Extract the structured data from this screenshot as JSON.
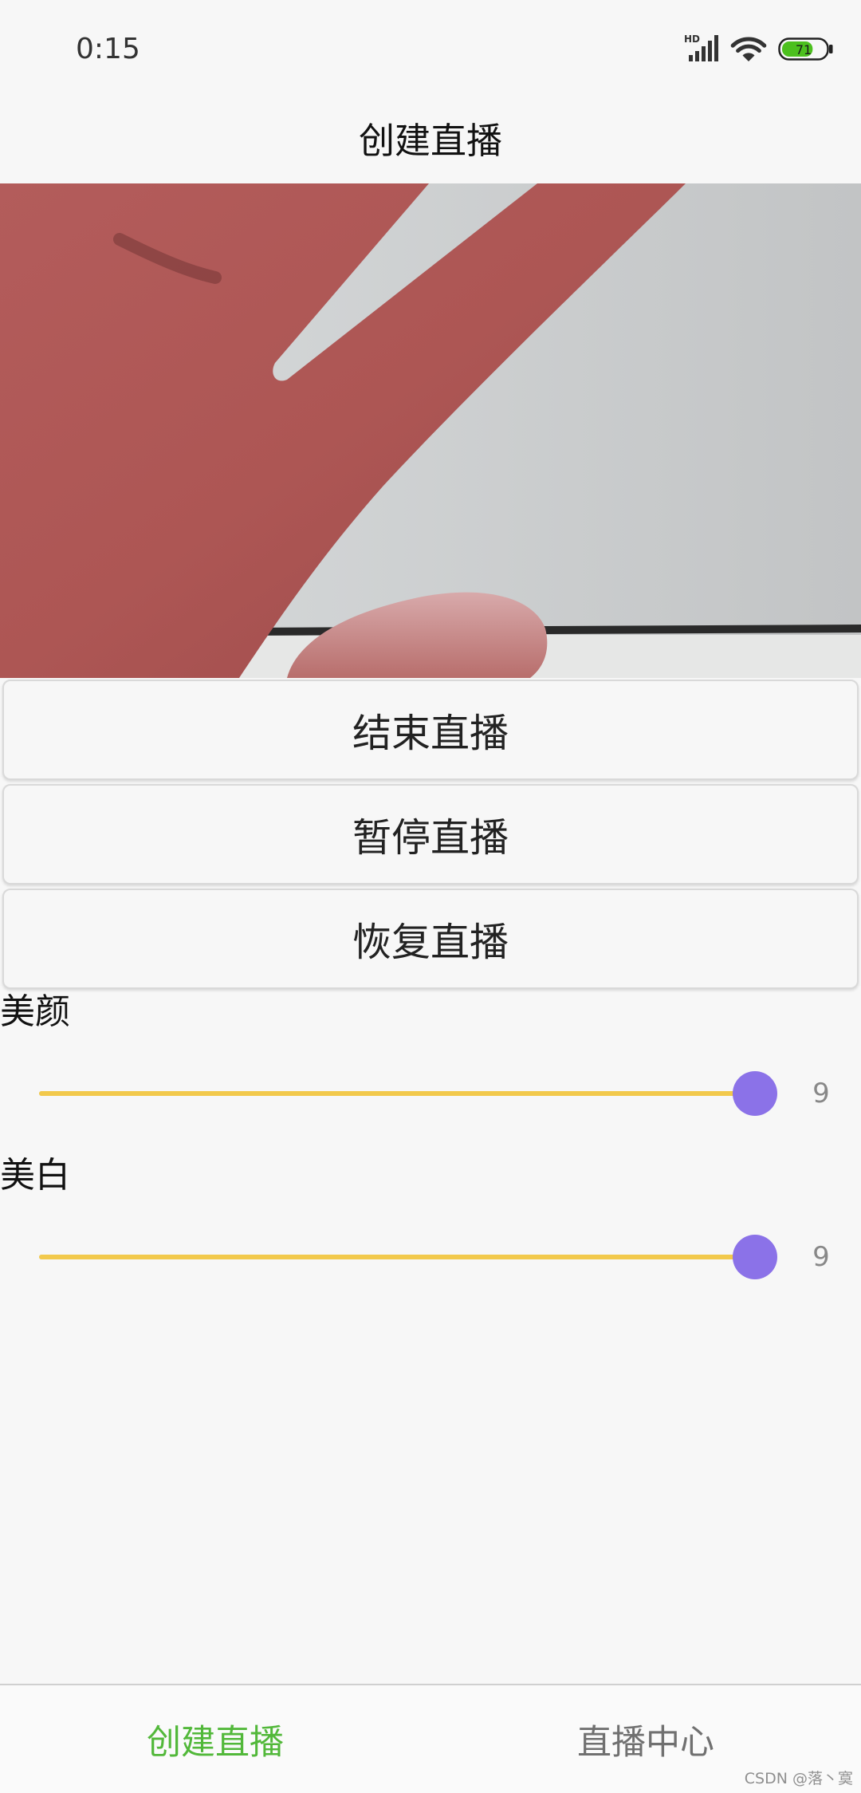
{
  "status_bar": {
    "time": "0:15",
    "network_badge": "HD",
    "battery_level": "71",
    "icons": [
      "signal-icon",
      "wifi-icon",
      "battery-icon"
    ]
  },
  "header": {
    "title": "创建直播"
  },
  "controls": {
    "buttons": [
      {
        "label": "结束直播"
      },
      {
        "label": "暂停直播"
      },
      {
        "label": "恢复直播"
      }
    ]
  },
  "sliders": [
    {
      "label": "美颜",
      "value": "9",
      "fraction": 1.0
    },
    {
      "label": "美白",
      "value": "9",
      "fraction": 1.0
    }
  ],
  "bottom_nav": {
    "tabs": [
      {
        "label": "创建直播",
        "active": true
      },
      {
        "label": "直播中心",
        "active": false
      }
    ]
  },
  "watermark": "CSDN @落丶寞",
  "colors": {
    "active_tab": "#52b83a",
    "inactive_tab": "#707070",
    "slider_track": "#f2c94c",
    "slider_thumb": "#8b72e8",
    "battery_fill": "#4cc01e",
    "background": "#f7f7f7"
  }
}
